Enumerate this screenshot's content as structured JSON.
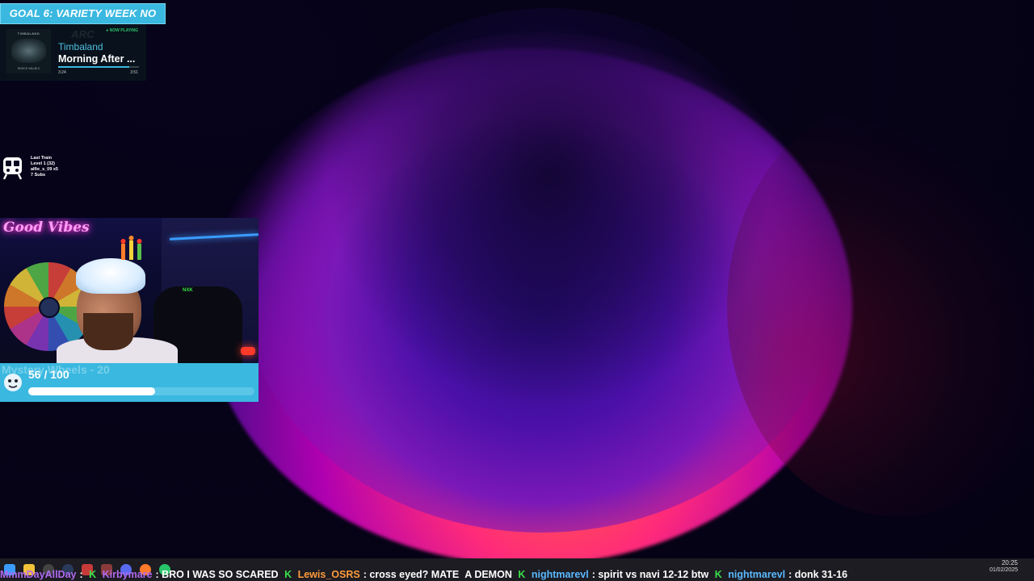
{
  "goal_banner": {
    "label": "GOAL 6: VARIETY WEEK NO ARC"
  },
  "now_playing": {
    "tag": "● NOW PLAYING",
    "album_text_top": "TIMBALAND",
    "album_text_bottom": "SHOCK VALUE II",
    "artist": "Timbaland",
    "title": "Morning After ...",
    "elapsed": "3:24",
    "duration": "3:51",
    "progress_fraction": 0.88
  },
  "train_widget": {
    "icon": "train-icon",
    "lines": [
      "Last Train",
      "Level 1 (32)",
      "alfie_s_09 x5",
      "7 Subs"
    ]
  },
  "webcam": {
    "neon_sign": "Good Vibes",
    "chair_brand": "NXK"
  },
  "sub_goal": {
    "ghost_text": "Mystery Wheels - 20",
    "count": "56 / 100",
    "progress_fraction": 0.56
  },
  "chat_ticker": [
    {
      "user": "MmmDayAllDay",
      "color": "purple",
      "message": ": "
    },
    {
      "user": "Kirbymare",
      "color": "purple",
      "message": ": BRO I WAS SO SCARED"
    },
    {
      "user": "Lewis_OSRS",
      "color": "orange",
      "message": ": cross eyed? MATE"
    },
    {
      "user": "",
      "color": "white",
      "message": "A DEMON"
    },
    {
      "user": "nightmarevl",
      "color": "cyan",
      "message": ": spirit vs navi 12-12 btw"
    },
    {
      "user": "nightmarevl",
      "color": "cyan",
      "message": ": donk 31-16"
    }
  ],
  "clock": {
    "time": "20:25",
    "date": "01/02/2025"
  },
  "colors": {
    "accent": "#3ab8e0",
    "taskbar": "#1c1c22",
    "now_playing_green": "#29c46a"
  }
}
